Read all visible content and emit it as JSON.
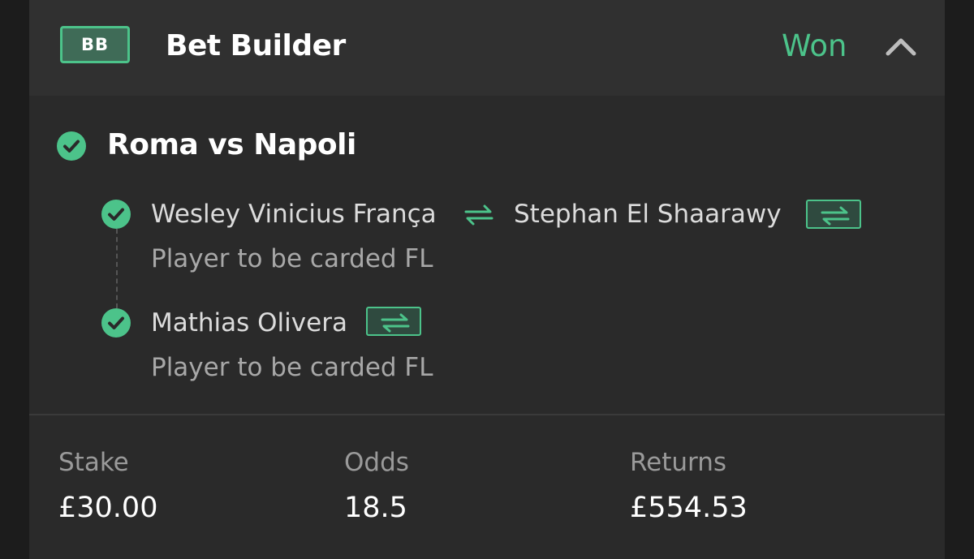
{
  "header": {
    "badge": "BB",
    "title": "Bet Builder",
    "status": "Won",
    "collapse_icon": "chevron-up-icon"
  },
  "match": {
    "title": "Roma vs Napoli",
    "icon": "check-circle-icon"
  },
  "legs": [
    {
      "player_out": "Wesley Vinicius França",
      "player_in": "Stephan El Shaarawy",
      "market": "Player to be carded FL"
    },
    {
      "player": "Mathias Olivera",
      "market": "Player to be carded FL"
    }
  ],
  "summary": {
    "stake_label": "Stake",
    "stake_value": "£30.00",
    "odds_label": "Odds",
    "odds_value": "18.5",
    "returns_label": "Returns",
    "returns_value": "£554.53"
  },
  "colors": {
    "accent": "#4cc38a",
    "background": "#2a2a2a",
    "header_background": "#303030"
  }
}
